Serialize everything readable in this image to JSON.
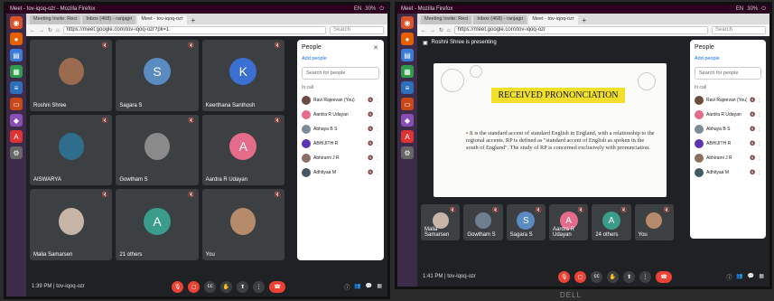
{
  "left": {
    "topbar": {
      "title": "Meet - tov-iqoq-ozr - Mozilla Firefox",
      "tray": [
        "EN",
        "30%",
        "⏻"
      ]
    },
    "browser": {
      "tabs": [
        {
          "label": "Meeting Invite: Reci"
        },
        {
          "label": "Inbox (468) - ranjagn"
        },
        {
          "label": "Meet - tov-iqoq-ozr",
          "active": true
        }
      ],
      "url": "https://meet.google.com/tov-iqoq-ozr?pli=1",
      "search_placeholder": "Search"
    },
    "tiles": [
      {
        "name": "Roshni Shree",
        "type": "photo",
        "color": "#9a6b4f"
      },
      {
        "name": "Sagara S",
        "type": "letter",
        "letter": "S",
        "color": "#5b8cc1"
      },
      {
        "name": "Keerthana Santhosh",
        "type": "letter",
        "letter": "K",
        "color": "#3b6fd1"
      },
      {
        "name": "AISWARYA",
        "type": "photo",
        "color": "#2e6e8c"
      },
      {
        "name": "Gowtham S",
        "type": "photo",
        "color": "#8a8a8a"
      },
      {
        "name": "Aardra R Udayan",
        "type": "letter",
        "letter": "A",
        "color": "#e56b8a"
      },
      {
        "name": "Malia Samarsen",
        "type": "photo",
        "color": "#c7b6a8"
      },
      {
        "name": "21 others",
        "type": "group",
        "letter": "A",
        "color": "#3a9c8b"
      },
      {
        "name": "You",
        "type": "photo",
        "color": "#b58b6b"
      }
    ],
    "people": {
      "title": "People",
      "add": "Add people",
      "search": "Search for people",
      "incall": "In call",
      "rows": [
        {
          "name": "Ravi Rajeevan (You)",
          "color": "#6d4c41"
        },
        {
          "name": "Aardra R Udayan",
          "color": "#e56b8a"
        },
        {
          "name": "Abhaya B S",
          "color": "#7b8c99"
        },
        {
          "name": "ABHIJITH R",
          "color": "#5e35b1"
        },
        {
          "name": "Abhirami J R",
          "color": "#8d6e63"
        },
        {
          "name": "Adhityaa M",
          "color": "#455a64"
        }
      ]
    },
    "controls": {
      "clock": "1:39 PM | tov-iqoq-ozr"
    }
  },
  "right": {
    "topbar": {
      "title": "Meet - Mozilla Firefox",
      "tray": [
        "EN",
        "30%",
        "⏻"
      ]
    },
    "browser": {
      "tabs": [
        {
          "label": "Meeting Invite: Reci"
        },
        {
          "label": "Inbox (468) - ranjagn"
        },
        {
          "label": "Meet - tov-iqoq-ozr",
          "active": true
        }
      ],
      "url": "https://meet.google.com/tov-iqoq-ozr",
      "search_placeholder": "Search"
    },
    "presenting": "Roshni Shree is presenting",
    "slide": {
      "title": "RECEIVED PRONONCIATION",
      "text": "It is the standard accent of standard English in England, with a relationship to the regional accents. RP is defined as \"standard accent of English as spoken in the south of England\". The study of RP is concerned exclusively with pronunciation."
    },
    "strip": [
      {
        "name": "Malia Samarsen",
        "type": "photo",
        "color": "#c7b6a8"
      },
      {
        "name": "Gowtham S",
        "type": "photo",
        "color": "#6f7e8c"
      },
      {
        "name": "Sagara S",
        "type": "letter",
        "letter": "S",
        "color": "#5b8cc1"
      },
      {
        "name": "Aardra R Udayan",
        "type": "letter",
        "letter": "A",
        "color": "#e56b8a"
      },
      {
        "name": "24 others",
        "type": "group",
        "letter": "A",
        "color": "#3a9c8b"
      },
      {
        "name": "You",
        "type": "photo",
        "color": "#b58b6b"
      }
    ],
    "people": {
      "title": "People",
      "add": "Add people",
      "search": "Search for people",
      "incall": "In call",
      "rows": [
        {
          "name": "Ravi Rajeevan (You)",
          "color": "#6d4c41"
        },
        {
          "name": "Aardra R Udayan",
          "color": "#e56b8a"
        },
        {
          "name": "Abhaya B S",
          "color": "#7b8c99"
        },
        {
          "name": "ABHIJITH R",
          "color": "#5e35b1"
        },
        {
          "name": "Abhirami J R",
          "color": "#8d6e63"
        },
        {
          "name": "Adhityaa M",
          "color": "#455a64"
        }
      ]
    },
    "controls": {
      "clock": "1:41 PM | tov-iqoq-ozr"
    }
  },
  "bezel_brand": "DELL"
}
